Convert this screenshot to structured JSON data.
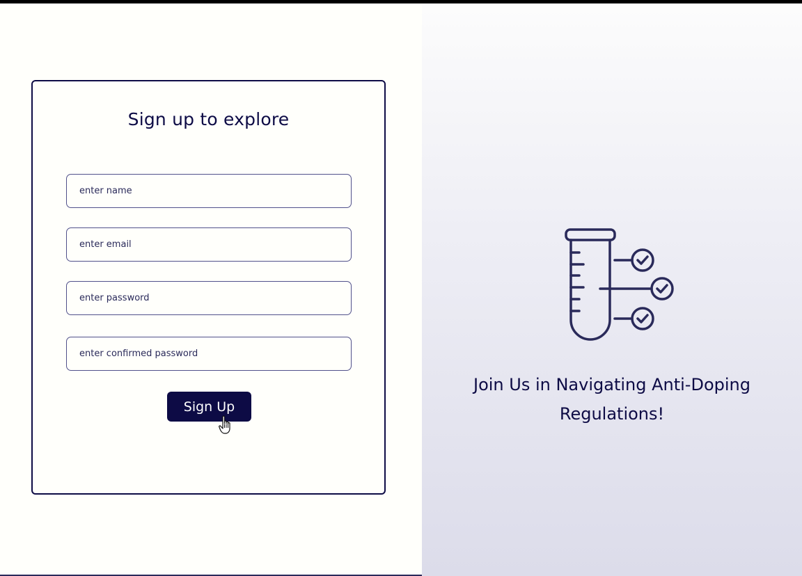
{
  "signup_card": {
    "title": "Sign up to explore",
    "name_placeholder": "enter name",
    "email_placeholder": "enter email",
    "password_placeholder": "enter password",
    "confirm_password_placeholder": "enter confirmed password",
    "submit_label": "Sign Up"
  },
  "hero": {
    "icon": "test-tube-check-icon",
    "tagline": "Join Us in Navigating Anti-Doping Regulations!"
  },
  "colors": {
    "primary": "#0d0b45",
    "field_border": "#50508a",
    "left_background": "#fffffb",
    "right_background_top": "#fcfcfc",
    "right_background_bottom": "#dcdcea"
  }
}
